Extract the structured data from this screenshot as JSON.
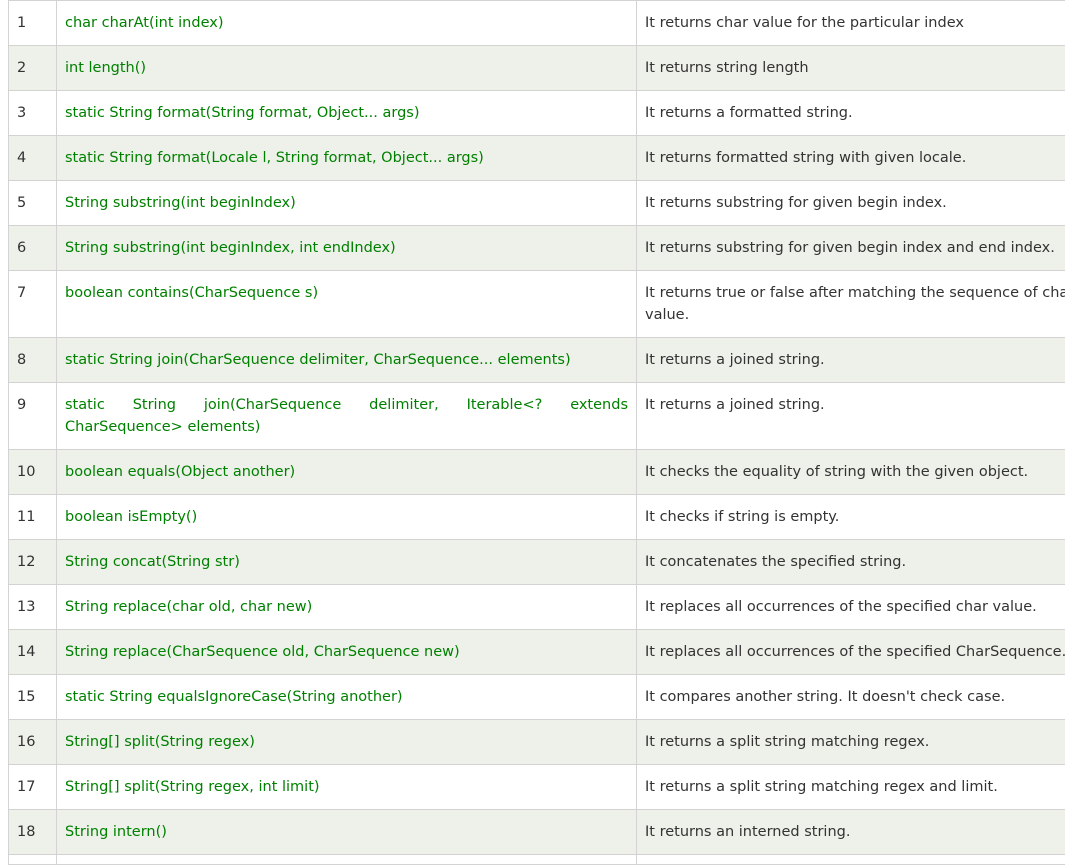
{
  "rows": [
    {
      "no": "1",
      "method": "char charAt(int index)",
      "desc": "It returns char value for the particular index"
    },
    {
      "no": "2",
      "method": "int length()",
      "desc": "It returns string length"
    },
    {
      "no": "3",
      "method": "static String format(String format, Object... args)",
      "desc": "It returns a formatted string."
    },
    {
      "no": "4",
      "method": "static String format(Locale l, String format, Object... args)",
      "desc": "It returns formatted string with given locale."
    },
    {
      "no": "5",
      "method": "String substring(int beginIndex)",
      "desc": "It returns substring for given begin index."
    },
    {
      "no": "6",
      "method": "String substring(int beginIndex, int endIndex)",
      "desc": "It returns substring for given begin index and end index."
    },
    {
      "no": "7",
      "method": "boolean contains(CharSequence s)",
      "desc": "It returns true or false after matching the sequence of char value."
    },
    {
      "no": "8",
      "method": "static String join(CharSequence delimiter, CharSequence... elements)",
      "desc": "It returns a joined string."
    },
    {
      "no": "9",
      "method": "static String join(CharSequence delimiter, Iterable<? extends CharSequence> elements)",
      "desc": "It returns a joined string."
    },
    {
      "no": "10",
      "method": "boolean equals(Object another)",
      "desc": "It checks the equality of string with the given object."
    },
    {
      "no": "11",
      "method": "boolean isEmpty()",
      "desc": "It checks if string is empty."
    },
    {
      "no": "12",
      "method": "String concat(String str)",
      "desc": "It concatenates the specified string."
    },
    {
      "no": "13",
      "method": "String replace(char old, char new)",
      "desc": "It replaces all occurrences of the specified char value."
    },
    {
      "no": "14",
      "method": "String replace(CharSequence old, CharSequence new)",
      "desc": "It replaces all occurrences of the specified CharSequence."
    },
    {
      "no": "15",
      "method": "static String equalsIgnoreCase(String another)",
      "desc": "It compares another string. It doesn't check case."
    },
    {
      "no": "16",
      "method": "String[] split(String regex)",
      "desc": "It returns a split string matching regex."
    },
    {
      "no": "17",
      "method": "String[] split(String regex, int limit)",
      "desc": "It returns a split string matching regex and limit."
    },
    {
      "no": "18",
      "method": "String intern()",
      "desc": "It returns an interned string."
    }
  ]
}
